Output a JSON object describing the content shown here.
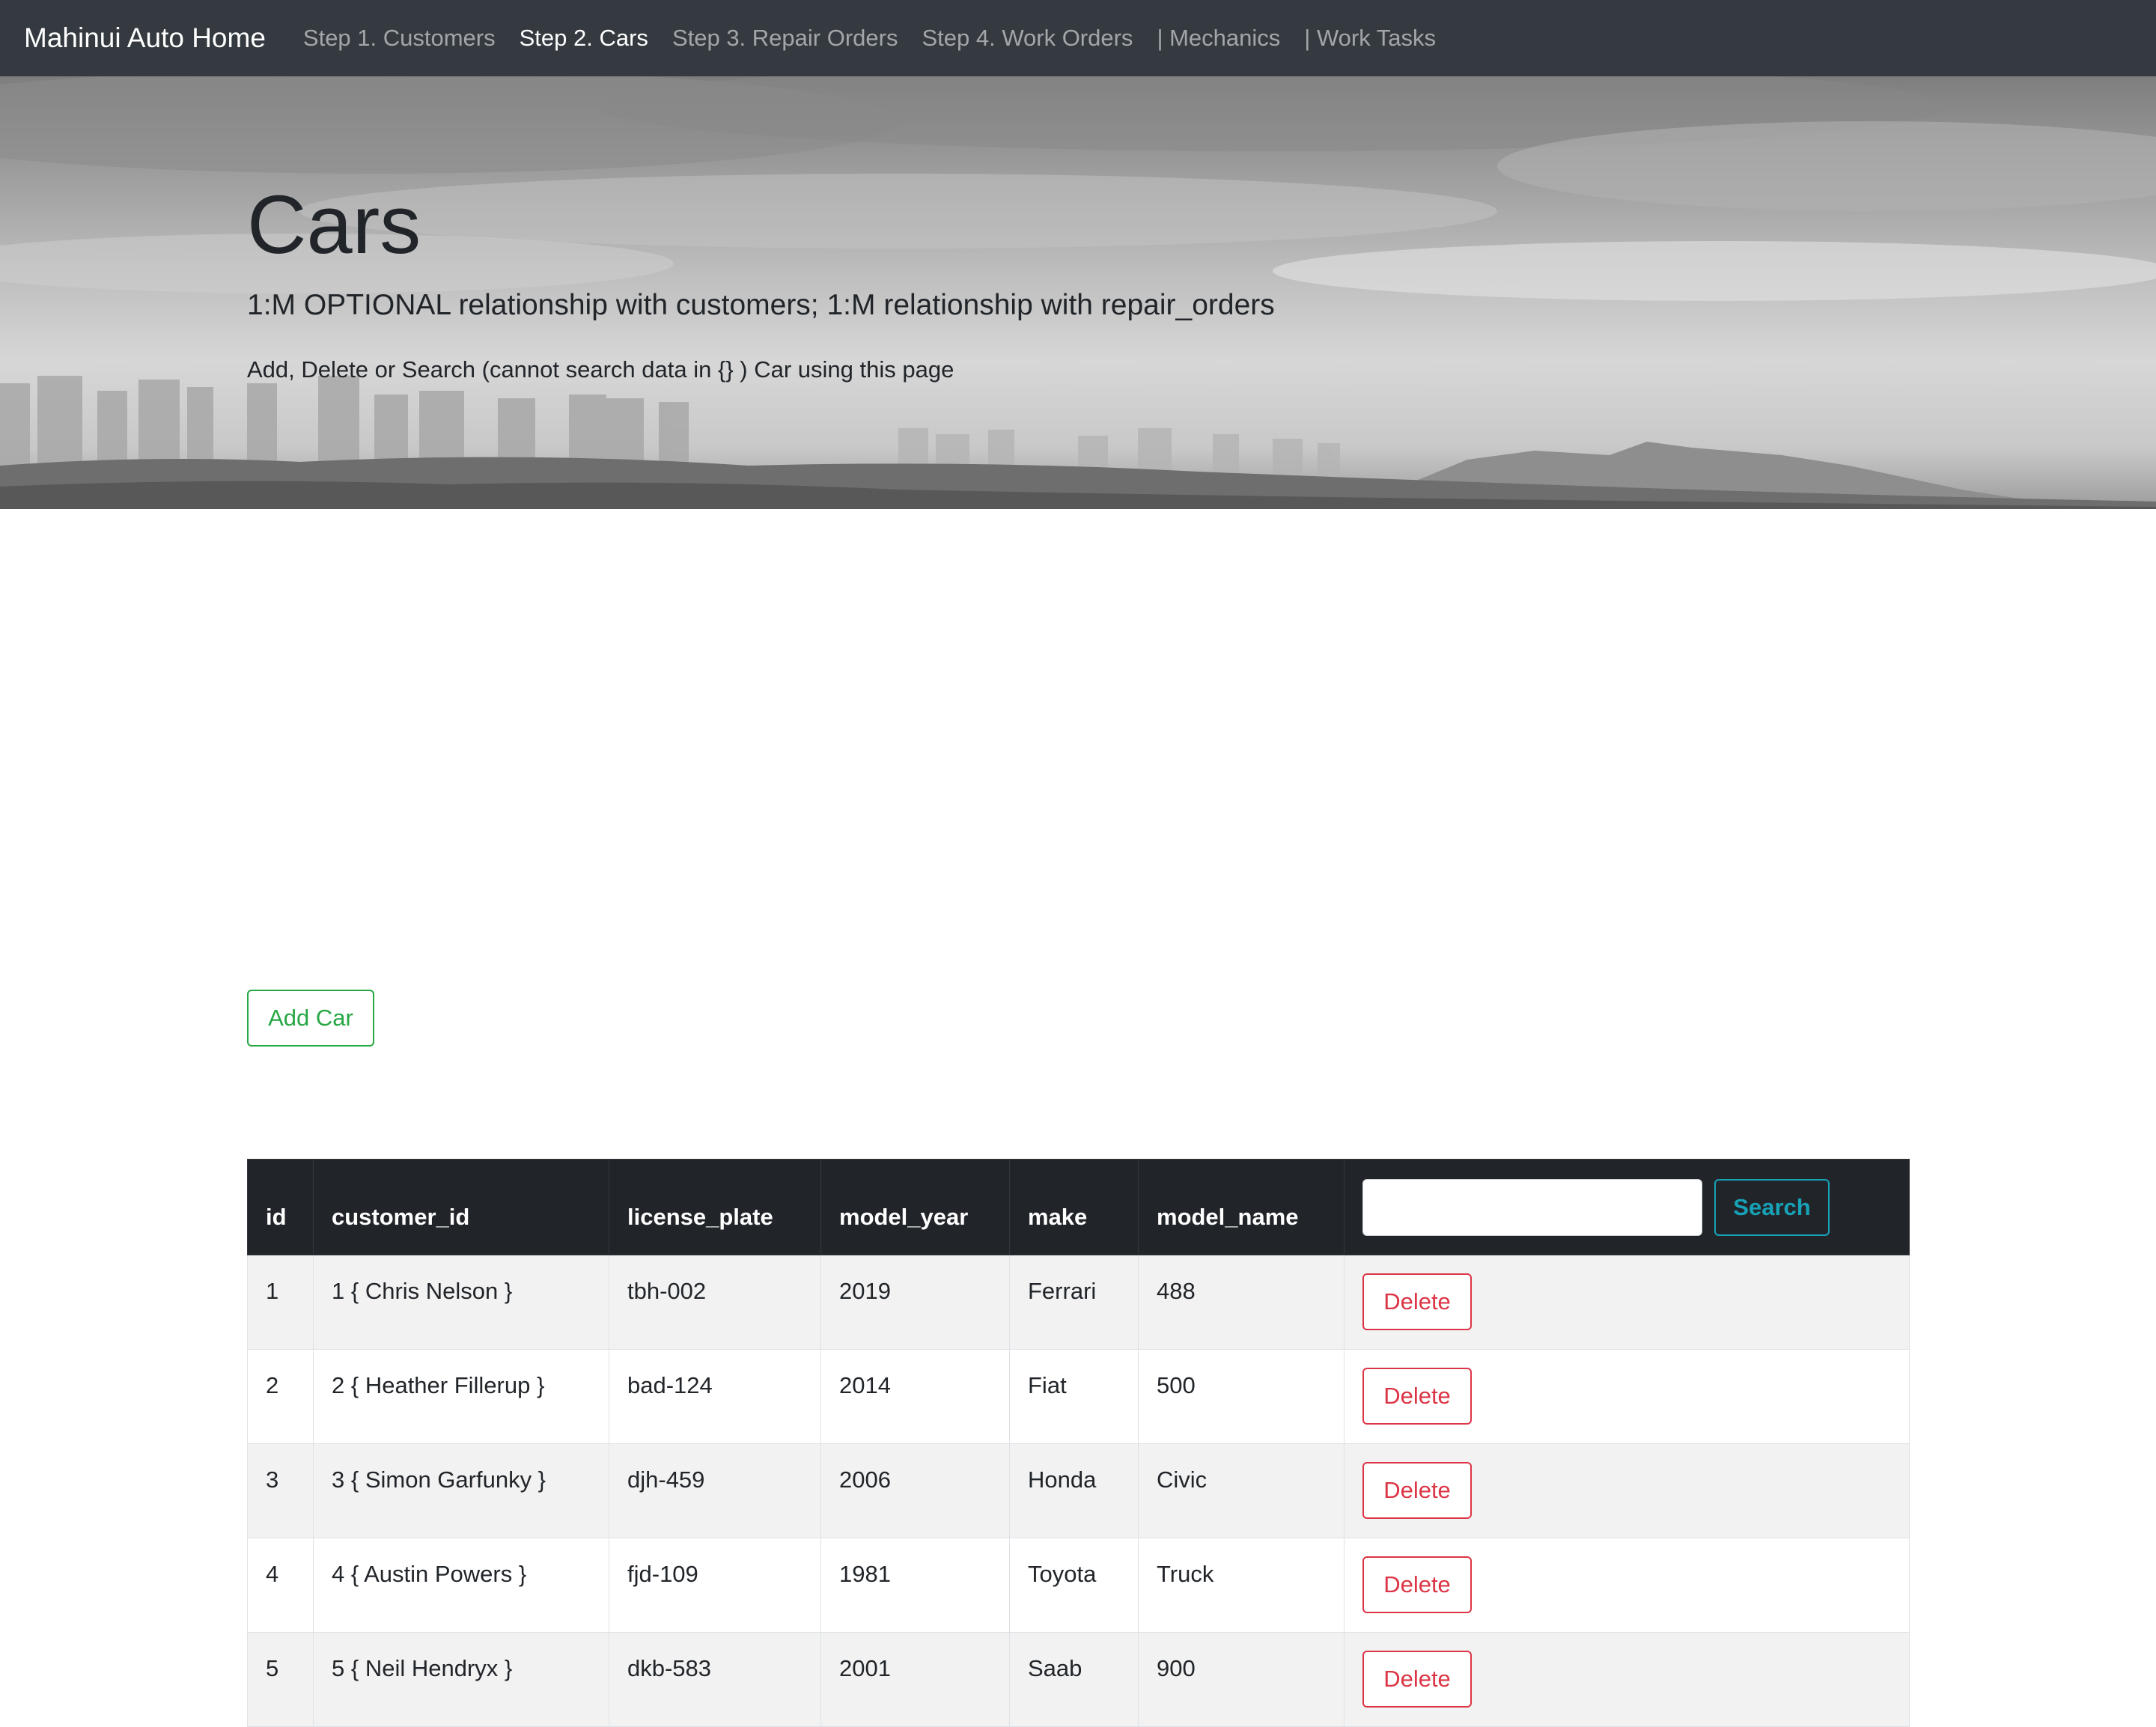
{
  "navbar": {
    "brand": "Mahinui Auto Home",
    "items": [
      {
        "label": "Step 1. Customers",
        "active": false
      },
      {
        "label": "Step 2. Cars",
        "active": true
      },
      {
        "label": "Step 3. Repair Orders",
        "active": false
      },
      {
        "label": "Step 4. Work Orders",
        "active": false
      },
      {
        "label": "| Mechanics",
        "active": false
      },
      {
        "label": "| Work Tasks",
        "active": false
      }
    ]
  },
  "hero": {
    "title": "Cars",
    "lead": "1:M OPTIONAL relationship with customers; 1:M relationship with repair_orders",
    "note": "Add, Delete or Search (cannot search data in {} ) Car using this page"
  },
  "actions": {
    "add_label": "Add Car",
    "search_label": "Search",
    "search_value": ""
  },
  "table": {
    "columns": [
      "id",
      "customer_id",
      "license_plate",
      "model_year",
      "make",
      "model_name"
    ],
    "delete_label": "Delete",
    "rows": [
      {
        "id": "1",
        "customer_id": "1 { Chris Nelson }",
        "license_plate": "tbh-002",
        "model_year": "2019",
        "make": "Ferrari",
        "model_name": "488"
      },
      {
        "id": "2",
        "customer_id": "2 { Heather Fillerup }",
        "license_plate": "bad-124",
        "model_year": "2014",
        "make": "Fiat",
        "model_name": "500"
      },
      {
        "id": "3",
        "customer_id": "3 { Simon Garfunky }",
        "license_plate": "djh-459",
        "model_year": "2006",
        "make": "Honda",
        "model_name": "Civic"
      },
      {
        "id": "4",
        "customer_id": "4 { Austin Powers }",
        "license_plate": "fjd-109",
        "model_year": "1981",
        "make": "Toyota",
        "model_name": "Truck"
      },
      {
        "id": "5",
        "customer_id": "5 { Neil Hendryx }",
        "license_plate": "dkb-583",
        "model_year": "2001",
        "make": "Saab",
        "model_name": "900"
      }
    ]
  },
  "colors": {
    "navbar_bg": "#343a40",
    "table_header_bg": "#212529",
    "add_button": "#28a745",
    "search_button": "#17a2b8",
    "delete_button": "#dc3545"
  }
}
